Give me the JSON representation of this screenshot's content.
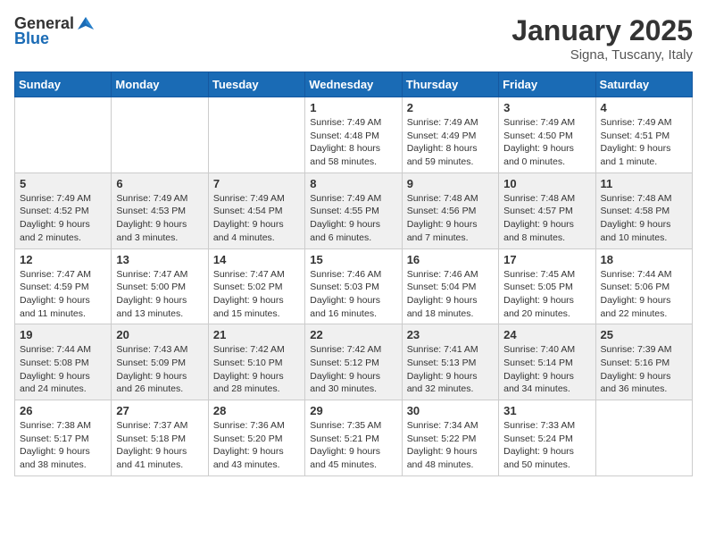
{
  "header": {
    "logo_general": "General",
    "logo_blue": "Blue",
    "month_title": "January 2025",
    "location": "Signa, Tuscany, Italy"
  },
  "weekdays": [
    "Sunday",
    "Monday",
    "Tuesday",
    "Wednesday",
    "Thursday",
    "Friday",
    "Saturday"
  ],
  "weeks": [
    [
      {
        "day": "",
        "sunrise": "",
        "sunset": "",
        "daylight": ""
      },
      {
        "day": "",
        "sunrise": "",
        "sunset": "",
        "daylight": ""
      },
      {
        "day": "",
        "sunrise": "",
        "sunset": "",
        "daylight": ""
      },
      {
        "day": "1",
        "sunrise": "Sunrise: 7:49 AM",
        "sunset": "Sunset: 4:48 PM",
        "daylight": "Daylight: 8 hours and 58 minutes."
      },
      {
        "day": "2",
        "sunrise": "Sunrise: 7:49 AM",
        "sunset": "Sunset: 4:49 PM",
        "daylight": "Daylight: 8 hours and 59 minutes."
      },
      {
        "day": "3",
        "sunrise": "Sunrise: 7:49 AM",
        "sunset": "Sunset: 4:50 PM",
        "daylight": "Daylight: 9 hours and 0 minutes."
      },
      {
        "day": "4",
        "sunrise": "Sunrise: 7:49 AM",
        "sunset": "Sunset: 4:51 PM",
        "daylight": "Daylight: 9 hours and 1 minute."
      }
    ],
    [
      {
        "day": "5",
        "sunrise": "Sunrise: 7:49 AM",
        "sunset": "Sunset: 4:52 PM",
        "daylight": "Daylight: 9 hours and 2 minutes."
      },
      {
        "day": "6",
        "sunrise": "Sunrise: 7:49 AM",
        "sunset": "Sunset: 4:53 PM",
        "daylight": "Daylight: 9 hours and 3 minutes."
      },
      {
        "day": "7",
        "sunrise": "Sunrise: 7:49 AM",
        "sunset": "Sunset: 4:54 PM",
        "daylight": "Daylight: 9 hours and 4 minutes."
      },
      {
        "day": "8",
        "sunrise": "Sunrise: 7:49 AM",
        "sunset": "Sunset: 4:55 PM",
        "daylight": "Daylight: 9 hours and 6 minutes."
      },
      {
        "day": "9",
        "sunrise": "Sunrise: 7:48 AM",
        "sunset": "Sunset: 4:56 PM",
        "daylight": "Daylight: 9 hours and 7 minutes."
      },
      {
        "day": "10",
        "sunrise": "Sunrise: 7:48 AM",
        "sunset": "Sunset: 4:57 PM",
        "daylight": "Daylight: 9 hours and 8 minutes."
      },
      {
        "day": "11",
        "sunrise": "Sunrise: 7:48 AM",
        "sunset": "Sunset: 4:58 PM",
        "daylight": "Daylight: 9 hours and 10 minutes."
      }
    ],
    [
      {
        "day": "12",
        "sunrise": "Sunrise: 7:47 AM",
        "sunset": "Sunset: 4:59 PM",
        "daylight": "Daylight: 9 hours and 11 minutes."
      },
      {
        "day": "13",
        "sunrise": "Sunrise: 7:47 AM",
        "sunset": "Sunset: 5:00 PM",
        "daylight": "Daylight: 9 hours and 13 minutes."
      },
      {
        "day": "14",
        "sunrise": "Sunrise: 7:47 AM",
        "sunset": "Sunset: 5:02 PM",
        "daylight": "Daylight: 9 hours and 15 minutes."
      },
      {
        "day": "15",
        "sunrise": "Sunrise: 7:46 AM",
        "sunset": "Sunset: 5:03 PM",
        "daylight": "Daylight: 9 hours and 16 minutes."
      },
      {
        "day": "16",
        "sunrise": "Sunrise: 7:46 AM",
        "sunset": "Sunset: 5:04 PM",
        "daylight": "Daylight: 9 hours and 18 minutes."
      },
      {
        "day": "17",
        "sunrise": "Sunrise: 7:45 AM",
        "sunset": "Sunset: 5:05 PM",
        "daylight": "Daylight: 9 hours and 20 minutes."
      },
      {
        "day": "18",
        "sunrise": "Sunrise: 7:44 AM",
        "sunset": "Sunset: 5:06 PM",
        "daylight": "Daylight: 9 hours and 22 minutes."
      }
    ],
    [
      {
        "day": "19",
        "sunrise": "Sunrise: 7:44 AM",
        "sunset": "Sunset: 5:08 PM",
        "daylight": "Daylight: 9 hours and 24 minutes."
      },
      {
        "day": "20",
        "sunrise": "Sunrise: 7:43 AM",
        "sunset": "Sunset: 5:09 PM",
        "daylight": "Daylight: 9 hours and 26 minutes."
      },
      {
        "day": "21",
        "sunrise": "Sunrise: 7:42 AM",
        "sunset": "Sunset: 5:10 PM",
        "daylight": "Daylight: 9 hours and 28 minutes."
      },
      {
        "day": "22",
        "sunrise": "Sunrise: 7:42 AM",
        "sunset": "Sunset: 5:12 PM",
        "daylight": "Daylight: 9 hours and 30 minutes."
      },
      {
        "day": "23",
        "sunrise": "Sunrise: 7:41 AM",
        "sunset": "Sunset: 5:13 PM",
        "daylight": "Daylight: 9 hours and 32 minutes."
      },
      {
        "day": "24",
        "sunrise": "Sunrise: 7:40 AM",
        "sunset": "Sunset: 5:14 PM",
        "daylight": "Daylight: 9 hours and 34 minutes."
      },
      {
        "day": "25",
        "sunrise": "Sunrise: 7:39 AM",
        "sunset": "Sunset: 5:16 PM",
        "daylight": "Daylight: 9 hours and 36 minutes."
      }
    ],
    [
      {
        "day": "26",
        "sunrise": "Sunrise: 7:38 AM",
        "sunset": "Sunset: 5:17 PM",
        "daylight": "Daylight: 9 hours and 38 minutes."
      },
      {
        "day": "27",
        "sunrise": "Sunrise: 7:37 AM",
        "sunset": "Sunset: 5:18 PM",
        "daylight": "Daylight: 9 hours and 41 minutes."
      },
      {
        "day": "28",
        "sunrise": "Sunrise: 7:36 AM",
        "sunset": "Sunset: 5:20 PM",
        "daylight": "Daylight: 9 hours and 43 minutes."
      },
      {
        "day": "29",
        "sunrise": "Sunrise: 7:35 AM",
        "sunset": "Sunset: 5:21 PM",
        "daylight": "Daylight: 9 hours and 45 minutes."
      },
      {
        "day": "30",
        "sunrise": "Sunrise: 7:34 AM",
        "sunset": "Sunset: 5:22 PM",
        "daylight": "Daylight: 9 hours and 48 minutes."
      },
      {
        "day": "31",
        "sunrise": "Sunrise: 7:33 AM",
        "sunset": "Sunset: 5:24 PM",
        "daylight": "Daylight: 9 hours and 50 minutes."
      },
      {
        "day": "",
        "sunrise": "",
        "sunset": "",
        "daylight": ""
      }
    ]
  ]
}
